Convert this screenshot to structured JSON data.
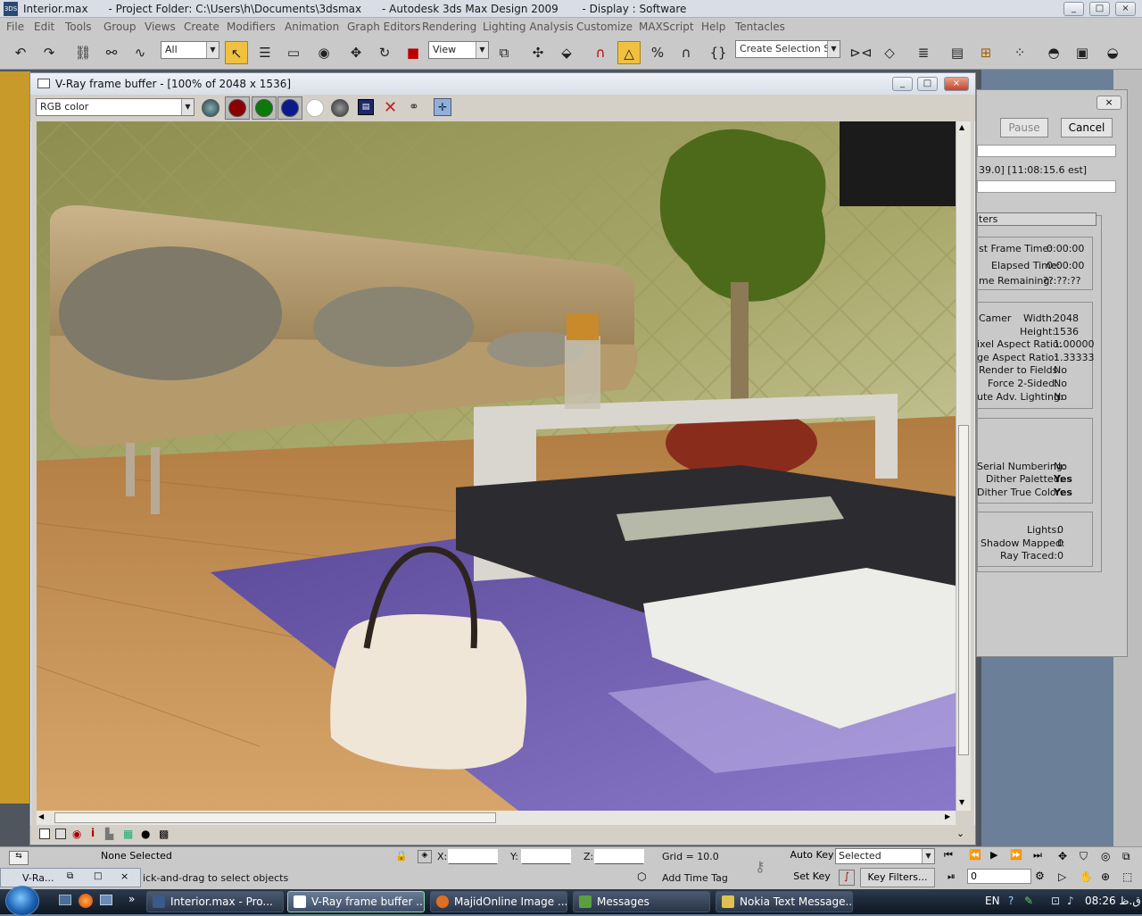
{
  "app": {
    "title": "Interior.max      - Project Folder: C:\\Users\\h\\Documents\\3dsmax      - Autodesk 3ds Max Design 2009       - Display : Software",
    "window_controls": {
      "minimize": "_",
      "maximize": "□",
      "close": "×"
    }
  },
  "menu": [
    "File",
    "Edit",
    "Tools",
    "Group",
    "Views",
    "Create",
    "Modifiers",
    "Animation",
    "Graph Editors",
    "Rendering",
    "Lighting Analysis",
    "Customize",
    "MAXScript",
    "Help",
    "Tentacles"
  ],
  "toolbar": {
    "filter_value": "All",
    "coord_value": "View",
    "selection_set_placeholder": "Create Selection Set"
  },
  "vray": {
    "title": "V-Ray frame buffer - [100% of 2048 x 1536]",
    "channel_value": "RGB color",
    "colors": {
      "red": "#8b0000",
      "green": "#0a7a0a",
      "blue": "#0a1a8c",
      "white": "#ffffff",
      "mono": "#555555"
    }
  },
  "render_dialog": {
    "pause_label": "Pause",
    "cancel_label": "Cancel",
    "progress_time": "39.0] [11:08:15.6 est]",
    "params_header": "ters",
    "last_frame_label": "st Frame Time:",
    "last_frame_value": "0:00:00",
    "elapsed_label": "Elapsed Time:",
    "elapsed_value": "0:00:00",
    "remaining_label": "me Remaining:",
    "remaining_value": "??:??:??",
    "camera_label": "Camer",
    "width_label": "Width:",
    "width_value": "2048",
    "height_label": "Height:",
    "height_value": "1536",
    "pixel_aspect_label": "ixel Aspect Ratio:",
    "pixel_aspect_value": "1.00000",
    "image_aspect_label": "ge Aspect Ratio:",
    "image_aspect_value": "1.33333",
    "render_fields_label": "Render to Fields:",
    "render_fields_value": "No",
    "force2_label": "Force 2-Sided:",
    "force2_value": "No",
    "adv_lighting_label": "ute Adv. Lighting:",
    "adv_lighting_value": "No",
    "serial_label": "Serial Numbering:",
    "serial_value": "No",
    "dither_pal_label": "Dither Paletted:",
    "dither_pal_value": "Yes",
    "dither_true_label": "Dither True Color:",
    "dither_true_value": "Yes",
    "lights_label": "Lights:",
    "lights_value": "0",
    "shadow_label": "Shadow Mapped:",
    "shadow_value": "0",
    "raytraced_label": "Ray Traced:",
    "raytraced_value": "0"
  },
  "status": {
    "selection": "None Selected",
    "prompt": "ick-and-drag to select objects",
    "x_label": "X:",
    "y_label": "Y:",
    "z_label": "Z:",
    "grid": "Grid = 10.0",
    "add_time_tag": "Add Time Tag",
    "auto_key": "Auto Key",
    "set_key": "Set Key",
    "key_mode_value": "Selected",
    "key_filters": "Key Filters...",
    "frame_value": "0",
    "minimized_label": "V-Ra..."
  },
  "taskbar": {
    "items": [
      "Interior.max      - Pro...",
      "V-Ray frame buffer ...",
      "MajidOnline Image ...",
      "Messages",
      "Nokia Text Message..."
    ],
    "language": "EN",
    "clock": "08:26 ق.ظ"
  }
}
